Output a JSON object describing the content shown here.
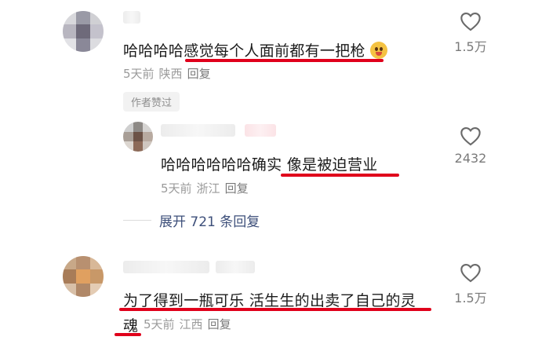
{
  "comments": [
    {
      "text": "哈哈哈哈感觉每个人面前都有一把枪",
      "meta": {
        "time": "5天前",
        "location": "陕西",
        "reply": "回复"
      },
      "likes": "1.5万",
      "badge": "作者赞过"
    },
    {
      "text": "哈哈哈哈哈哈确实 像是被迫营业",
      "meta": {
        "time": "5天前",
        "location": "浙江",
        "reply": "回复"
      },
      "likes": "2432"
    },
    {
      "text_line1": "为了得到一瓶可乐 活生生的出卖了自己的灵",
      "text_line2": "魂",
      "meta": {
        "time": "5天前",
        "location": "江西",
        "reply": "回复"
      },
      "likes": "1.5万"
    }
  ],
  "expand_replies": "展开 721 条回复",
  "colors": {
    "underline": "#e0001b",
    "link": "#3d4f7a",
    "meta": "#9a9a9a"
  },
  "icons": [
    "heart-outline-icon",
    "laughing-emoji-icon"
  ]
}
